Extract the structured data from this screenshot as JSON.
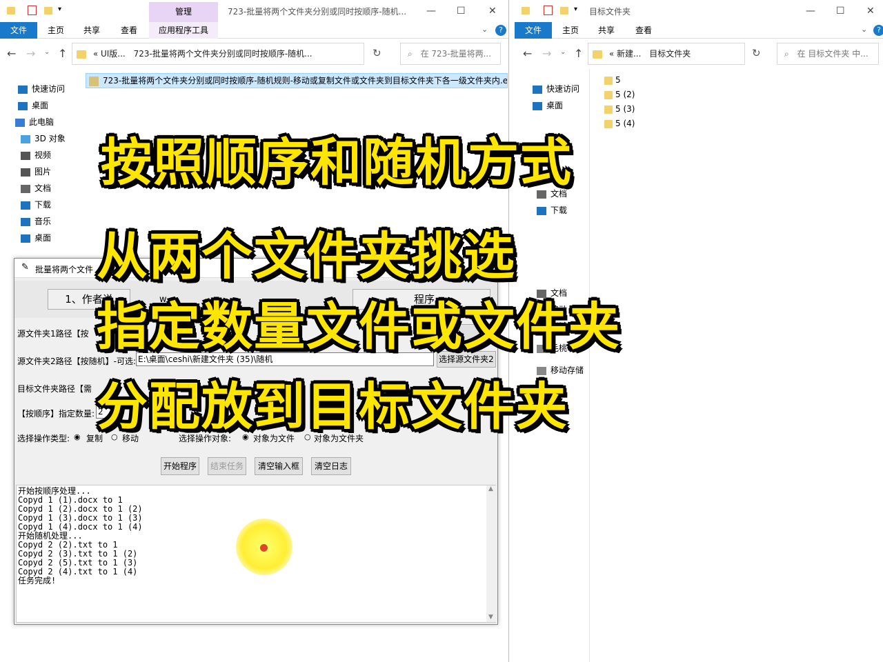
{
  "left_window": {
    "title": "723-批量将两个文件夹分别或同时按顺序-随机...",
    "context_tab": "管理",
    "tabs": [
      "文件",
      "主页",
      "共享",
      "查看",
      "应用程序工具"
    ],
    "breadcrumb_prefix": "«  UI版...",
    "breadcrumb": "723-批量将两个文件夹分别或同时按顺序-随机...",
    "search_placeholder": "在 723-批量将两...",
    "file_item": "723-批量将两个文件夹分别或同时按顺序-随机规则-移动或复制文件或文件夹到目标文件夹下各一级文件夹内.exe",
    "nav": [
      {
        "label": "快速访问",
        "icon": "star-icon"
      },
      {
        "label": "桌面",
        "icon": "desktop-icon"
      },
      {
        "label": "此电脑",
        "icon": "computer-icon"
      },
      {
        "label": "3D 对象",
        "icon": "cube-icon"
      },
      {
        "label": "视频",
        "icon": "video-icon"
      },
      {
        "label": "图片",
        "icon": "picture-icon"
      },
      {
        "label": "文档",
        "icon": "document-icon"
      },
      {
        "label": "下载",
        "icon": "download-icon"
      },
      {
        "label": "音乐",
        "icon": "music-icon"
      },
      {
        "label": "桌面",
        "icon": "desktop-icon"
      }
    ]
  },
  "right_window": {
    "title": "目标文件夹",
    "tabs": [
      "文件",
      "主页",
      "共享",
      "查看"
    ],
    "breadcrumb_prefix": "«  新建...",
    "breadcrumb": "目标文件夹",
    "search_placeholder": "在 目标文件夹 中...",
    "nav": [
      {
        "label": "快速访问",
        "icon": "star-icon"
      },
      {
        "label": "桌面",
        "icon": "desktop-icon"
      },
      {
        "label": "文档",
        "icon": "document-icon"
      },
      {
        "label": "下载",
        "icon": "download-icon"
      },
      {
        "label": "文档",
        "icon": "document-icon"
      },
      {
        "label": "移动",
        "icon": "drive-icon"
      },
      {
        "label": "考试",
        "icon": "drive-icon"
      },
      {
        "label": "毛桃U盘",
        "icon": "usb-icon"
      },
      {
        "label": "移动存储",
        "icon": "drive-icon"
      }
    ],
    "folders": [
      "5",
      "5 (2)",
      "5 (3)",
      "5 (4)"
    ]
  },
  "dialog": {
    "title": "批量将两个文件",
    "info_left": "1、作者说",
    "info_mid": "w",
    "info_right": "程序",
    "src1_label": "源文件夹1路径【按",
    "src1_button": "夹1",
    "src2_label": "源文件夹2路径【按随机】-可选:",
    "src2_value": "E:\\桌面\\ceshi\\新建文件夹 (35)\\随机",
    "src2_button": "选择源文件夹2",
    "target_label": "目标文件夹路径【需",
    "count_label": "【按顺序】指定数量:",
    "count_value": "2",
    "count_extra": "数量",
    "op_type_label": "选择操作类型:",
    "op_copy": "复制",
    "op_move": "移动",
    "op_obj_label": "选择操作对象:",
    "obj_file": "对象为文件",
    "obj_folder": "对象为文件夹",
    "buttons": {
      "start": "开始程序",
      "stop": "结束任务",
      "clear_input": "清空输入框",
      "clear_log": "清空日志"
    },
    "log": [
      "开始按顺序处理...",
      "Copyd 1 (1).docx to 1",
      "Copyd 1 (2).docx to 1 (2)",
      "Copyd 1 (3).docx to 1 (3)",
      "Copyd 1 (4).docx to 1 (4)",
      "开始随机处理...",
      "Copyd 2 (2).txt to 1",
      "Copyd 2 (3).txt to 1 (2)",
      "Copyd 2 (5).txt to 1 (3)",
      "Copyd 2 (4).txt to 1 (4)",
      "任务完成!"
    ]
  },
  "captions": {
    "line1": "按照顺序和随机方式",
    "line2": "从两个文件夹挑选",
    "line3": "指定数量文件或文件夹",
    "line4": "分配放到目标文件夹"
  },
  "colors": {
    "accent": "#1979ca",
    "caption": "#ffe600",
    "context_tab": "#e8d5f5"
  }
}
